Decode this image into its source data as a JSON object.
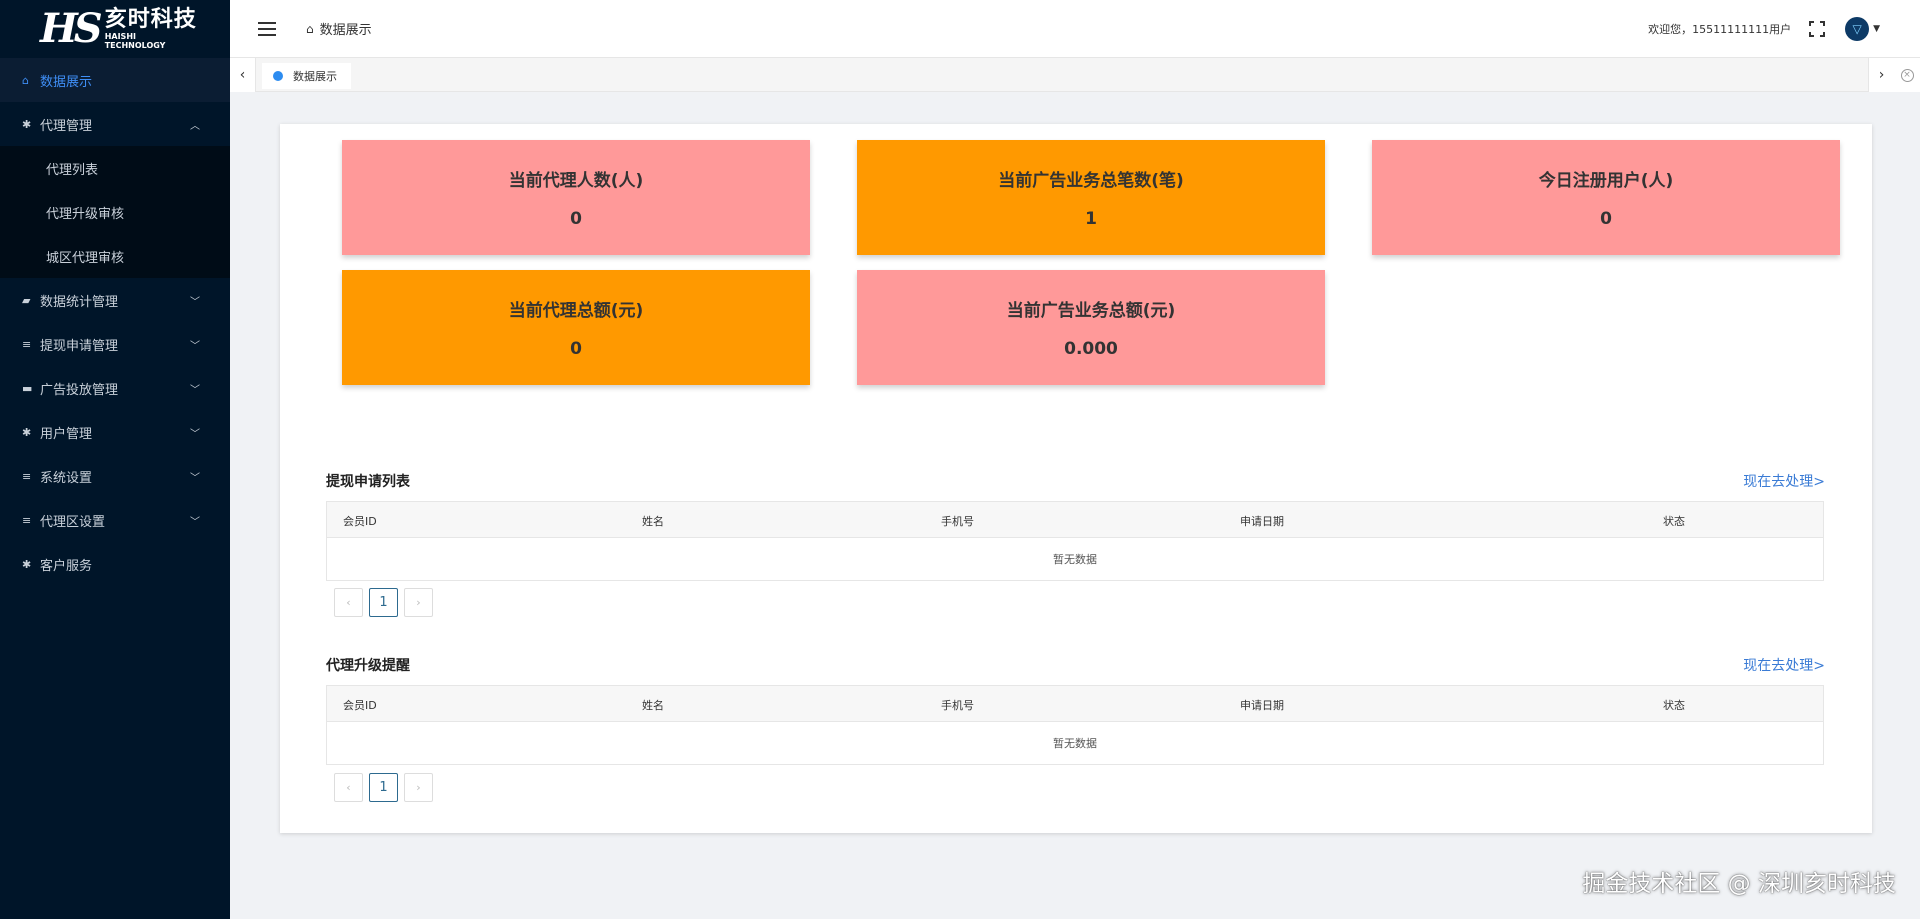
{
  "logo": {
    "mark": "HS",
    "cn": "亥时科技",
    "en_line1": "HAISHI",
    "en_line2": "TECHNOLOGY"
  },
  "sidebar": {
    "items": [
      {
        "label": "数据展示",
        "icon": "home-icon",
        "glyph": "⌂"
      },
      {
        "label": "代理管理",
        "icon": "gear-icon",
        "glyph": "✱"
      },
      {
        "label": "数据统计管理",
        "icon": "chat-icon",
        "glyph": "▰"
      },
      {
        "label": "提现申请管理",
        "icon": "list-icon",
        "glyph": "≡"
      },
      {
        "label": "广告投放管理",
        "icon": "folder-icon",
        "glyph": "▬"
      },
      {
        "label": "用户管理",
        "icon": "gear-icon",
        "glyph": "✱"
      },
      {
        "label": "系统设置",
        "icon": "list-icon",
        "glyph": "≡"
      },
      {
        "label": "代理区设置",
        "icon": "list-icon",
        "glyph": "≡"
      },
      {
        "label": "客户服务",
        "icon": "gear-icon",
        "glyph": "✱"
      }
    ],
    "submenu": [
      {
        "label": "代理列表"
      },
      {
        "label": "代理升级审核"
      },
      {
        "label": "城区代理审核"
      }
    ]
  },
  "header": {
    "breadcrumb": "数据展示",
    "welcome": "欢迎您，15511111111用户"
  },
  "tabs": [
    {
      "label": "数据展示"
    }
  ],
  "stats": [
    {
      "label": "当前代理人数(人)",
      "value": "0",
      "color": "#ff9999"
    },
    {
      "label": "当前广告业务总笔数(笔)",
      "value": "1",
      "color": "#ff9900"
    },
    {
      "label": "今日注册用户(人)",
      "value": "0",
      "color": "#ff9999"
    },
    {
      "label": "当前代理总额(元)",
      "value": "0",
      "color": "#ff9900"
    },
    {
      "label": "当前广告业务总额(元)",
      "value": "0.000",
      "color": "#ff9999"
    }
  ],
  "withdraw": {
    "title": "提现申请列表",
    "link": "现在去处理>",
    "columns": [
      "会员ID",
      "姓名",
      "手机号",
      "申请日期",
      "状态"
    ],
    "empty": "暂无数据",
    "page": "1"
  },
  "upgrade": {
    "title": "代理升级提醒",
    "link": "现在去处理>",
    "columns": [
      "会员ID",
      "姓名",
      "手机号",
      "申请日期",
      "状态"
    ],
    "empty": "暂无数据",
    "page": "1"
  },
  "watermark": "掘金技术社区 @ 深圳亥时科技",
  "colors": {
    "sidebar_bg": "#001529",
    "active": "#3f8ef5",
    "pink": "#ff9999",
    "orange": "#ff9900",
    "link": "#3a7bd5"
  }
}
